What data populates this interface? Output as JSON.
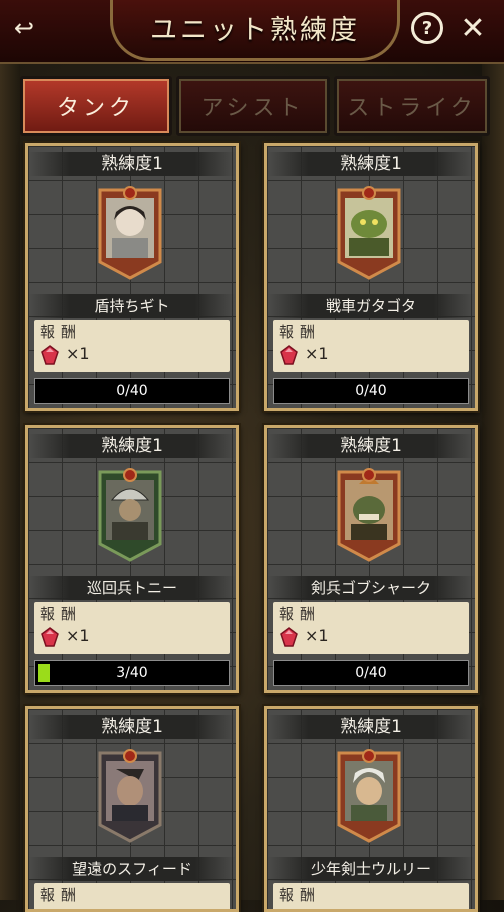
{
  "header": {
    "title": "ユニット熟練度",
    "back_icon": "back-arrow-icon",
    "help_icon": "help-icon",
    "close_icon": "close-icon",
    "help_label": "?",
    "close_label": "✕",
    "back_label": "↩"
  },
  "tabs": [
    {
      "label": "タンク",
      "active": true
    },
    {
      "label": "アシスト",
      "active": false
    },
    {
      "label": "ストライク",
      "active": false
    }
  ],
  "cards": [
    {
      "level": "熟練度1",
      "name": "盾持ちギト",
      "reward_label": "報酬",
      "reward_qty": "×1",
      "progress": "0/40",
      "progress_value": 0,
      "progress_max": 40
    },
    {
      "level": "熟練度1",
      "name": "戦車ガタゴタ",
      "reward_label": "報酬",
      "reward_qty": "×1",
      "progress": "0/40",
      "progress_value": 0,
      "progress_max": 40
    },
    {
      "level": "熟練度1",
      "name": "巡回兵トニー",
      "reward_label": "報酬",
      "reward_qty": "×1",
      "progress": "3/40",
      "progress_value": 3,
      "progress_max": 40
    },
    {
      "level": "熟練度1",
      "name": "剣兵ゴブシャーク",
      "reward_label": "報酬",
      "reward_qty": "×1",
      "progress": "0/40",
      "progress_value": 0,
      "progress_max": 40
    },
    {
      "level": "熟練度1",
      "name": "望遠のスフィード",
      "reward_label": "報酬"
    },
    {
      "level": "熟練度1",
      "name": "少年剣士ウルリー",
      "reward_label": "報酬"
    }
  ],
  "colors": {
    "accent": "#b53a2a",
    "progress": "#9bdc1a",
    "frame": "#c9a86a"
  }
}
